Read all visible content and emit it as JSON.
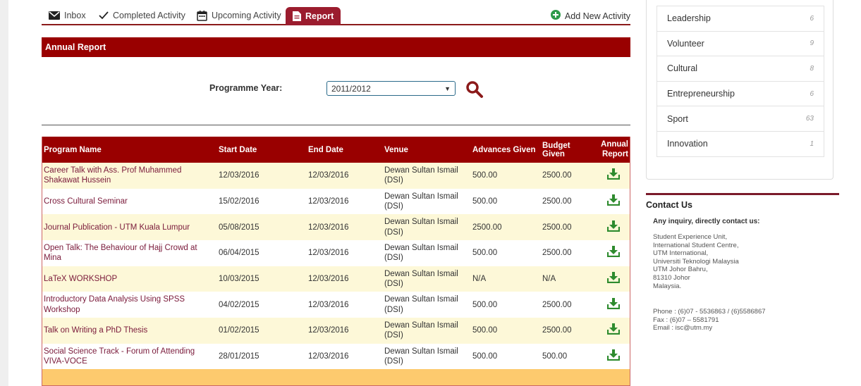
{
  "tabs": {
    "inbox": "Inbox",
    "completed": "Completed Activity",
    "upcoming": "Upcoming Activity",
    "report": "Report",
    "add_new": "Add New Activity"
  },
  "section": {
    "title": "Annual Report"
  },
  "filter": {
    "label": "Programme Year:",
    "selected": "2011/2012"
  },
  "table": {
    "headers": {
      "program": "Program Name",
      "start": "Start Date",
      "end": "End Date",
      "venue": "Venue",
      "advances": "Advances Given",
      "budget": "Budget Given",
      "annual_1": "Annual",
      "annual_2": "Report"
    },
    "rows": [
      {
        "program": "Career Talk with Ass. Prof Muhammed Shakawat Hussein",
        "start": "12/03/2016",
        "end": "12/03/2016",
        "venue": "Dewan Sultan Ismail (DSI)",
        "advances": "500.00",
        "budget": "2500.00"
      },
      {
        "program": "Cross Cultural Seminar",
        "start": "15/02/2016",
        "end": "12/03/2016",
        "venue": "Dewan Sultan Ismail (DSI)",
        "advances": "500.00",
        "budget": "2500.00"
      },
      {
        "program": "Journal Publication - UTM Kuala Lumpur",
        "start": "05/08/2015",
        "end": "12/03/2016",
        "venue": "Dewan Sultan Ismail (DSI)",
        "advances": "2500.00",
        "budget": "2500.00"
      },
      {
        "program": "Open Talk: The Behaviour of Hajj Crowd at Mina",
        "start": "06/04/2015",
        "end": "12/03/2016",
        "venue": "Dewan Sultan Ismail (DSI)",
        "advances": "500.00",
        "budget": "2500.00"
      },
      {
        "program": "LaTeX WORKSHOP",
        "start": "10/03/2015",
        "end": "12/03/2016",
        "venue": "Dewan Sultan Ismail (DSI)",
        "advances": "N/A",
        "budget": "N/A"
      },
      {
        "program": "Introductory Data Analysis Using SPSS Workshop",
        "start": "04/02/2015",
        "end": "12/03/2016",
        "venue": "Dewan Sultan Ismail (DSI)",
        "advances": "500.00",
        "budget": "2500.00"
      },
      {
        "program": "Talk on Writing a PhD Thesis",
        "start": "01/02/2015",
        "end": "12/03/2016",
        "venue": "Dewan Sultan Ismail (DSI)",
        "advances": "500.00",
        "budget": "2500.00"
      },
      {
        "program": "Social Science Track - Forum of Attending VIVA-VOCE",
        "start": "28/01/2015",
        "end": "12/03/2016",
        "venue": "Dewan Sultan Ismail (DSI)",
        "advances": "500.00",
        "budget": "500.00"
      }
    ]
  },
  "categories": [
    {
      "name": "Leadership",
      "count": "6"
    },
    {
      "name": "Volunteer",
      "count": "9"
    },
    {
      "name": "Cultural",
      "count": "8"
    },
    {
      "name": "Entrepreneurship",
      "count": "6"
    },
    {
      "name": "Sport",
      "count": "63"
    },
    {
      "name": "Innovation",
      "count": "1"
    }
  ],
  "contact": {
    "title": "Contact Us",
    "subtitle": "Any inquiry, directly contact us:",
    "address": [
      "Student Experience Unit,",
      "International Student Centre,",
      "UTM International,",
      "Universiti Teknologi Malaysia",
      "UTM Johor Bahru,",
      "81310 Johor",
      "Malaysia."
    ],
    "phone": "Phone : (6)07 - 5536863 / (6)5586867",
    "fax": "Fax : (6)07 – 5581791",
    "email": "Email : isc@utm.my"
  },
  "colors": {
    "brand": "#990000",
    "accent_green": "#2e8b2e",
    "row_alt": "#fdf8d8",
    "footer": "#fdca6e"
  },
  "icons": {
    "inbox": "envelope-icon",
    "completed": "checkmark-icon",
    "upcoming": "calendar-icon",
    "report": "document-icon",
    "add": "plus-circle-icon",
    "search": "search-icon",
    "download": "download-icon"
  }
}
